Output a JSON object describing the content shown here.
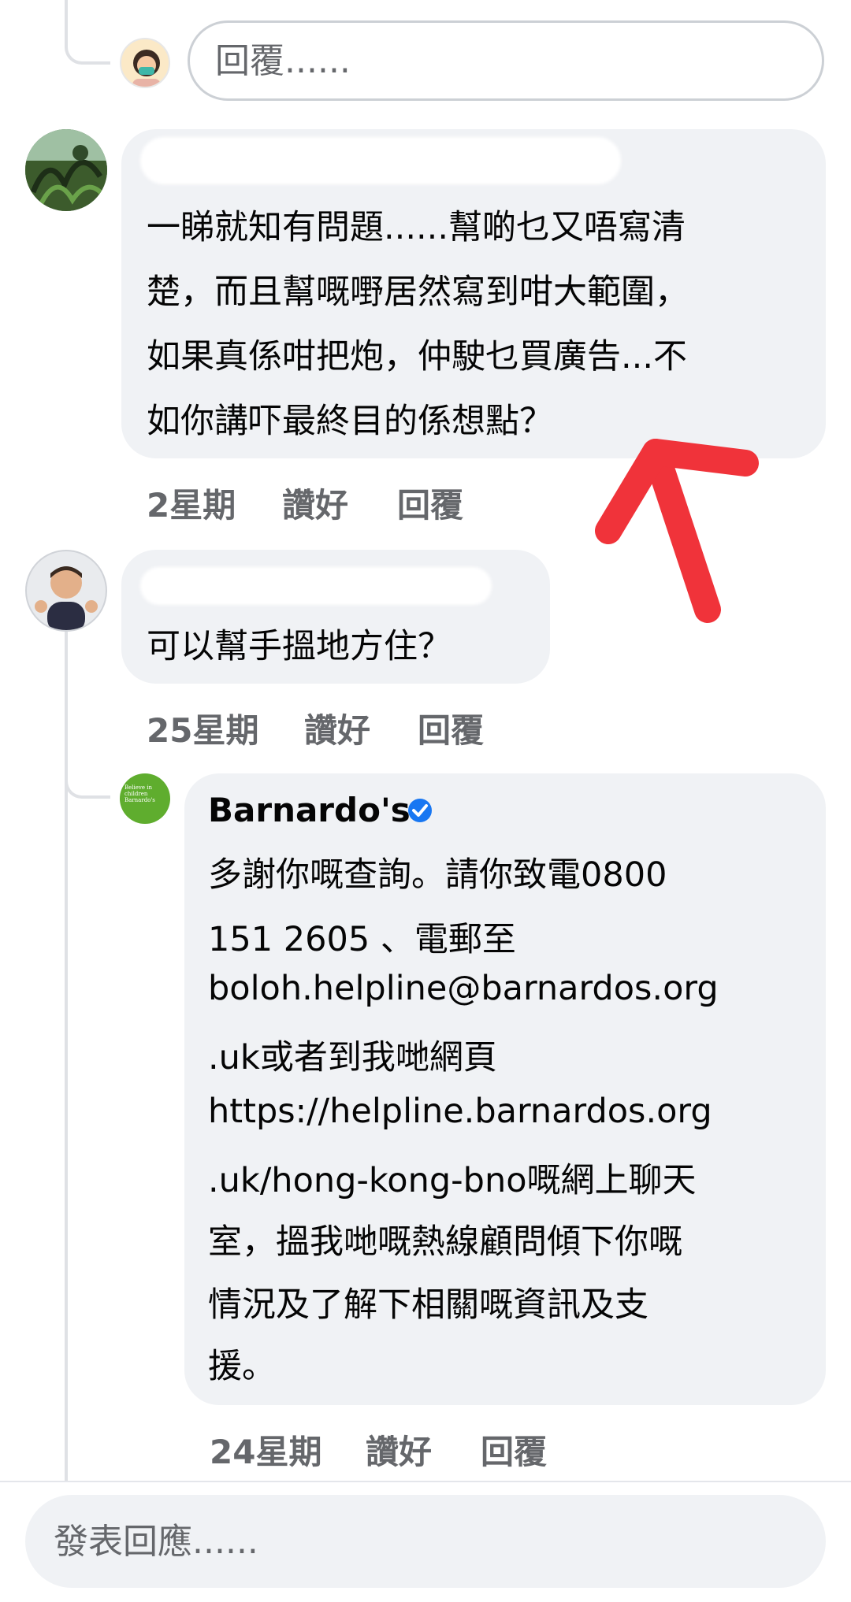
{
  "top_reply": {
    "placeholder": "回覆......"
  },
  "comments": [
    {
      "author": "",
      "text_lines": [
        "一睇就知有問題......幫啲乜又唔寫清",
        "楚，而且幫嘅嘢居然寫到咁大範圍，",
        "如果真係咁把炮，仲駛乜買廣告...不",
        "如你講吓最終目的係想點？"
      ],
      "time": "2星期",
      "like_label": "讚好",
      "reply_label": "回覆"
    },
    {
      "author": "",
      "text_lines": [
        "可以幫手搵地方住？"
      ],
      "time": "25星期",
      "like_label": "讚好",
      "reply_label": "回覆"
    }
  ],
  "page_reply": {
    "author": "Barnardo's",
    "verified": true,
    "avatar_text_lines": [
      "Believe in",
      "children",
      "Barnardo's"
    ],
    "brand_color": "#5fad2e",
    "text_lines": [
      "多謝你嘅查詢。請你致電0800",
      "151 2605 、電郵至",
      "boloh.helpline@barnardos.org",
      ".uk或者到我哋網頁",
      "https://helpline.barnardos.org",
      ".uk/hong-kong-bno嘅網上聊天",
      "室，搵我哋嘅熱線顧問傾下你嘅",
      "情況及了解下相關嘅資訊及支",
      "援。"
    ],
    "time": "24星期",
    "like_label": "讚好",
    "reply_label": "回覆"
  },
  "compose": {
    "placeholder": "發表回應......"
  },
  "annotation": {
    "arrow_color": "#f0333a"
  },
  "icons": {
    "verified": "verified-badge-icon"
  },
  "colors": {
    "bubble": "#f0f2f5",
    "meta": "#65676b",
    "verified": "#1877f2"
  }
}
